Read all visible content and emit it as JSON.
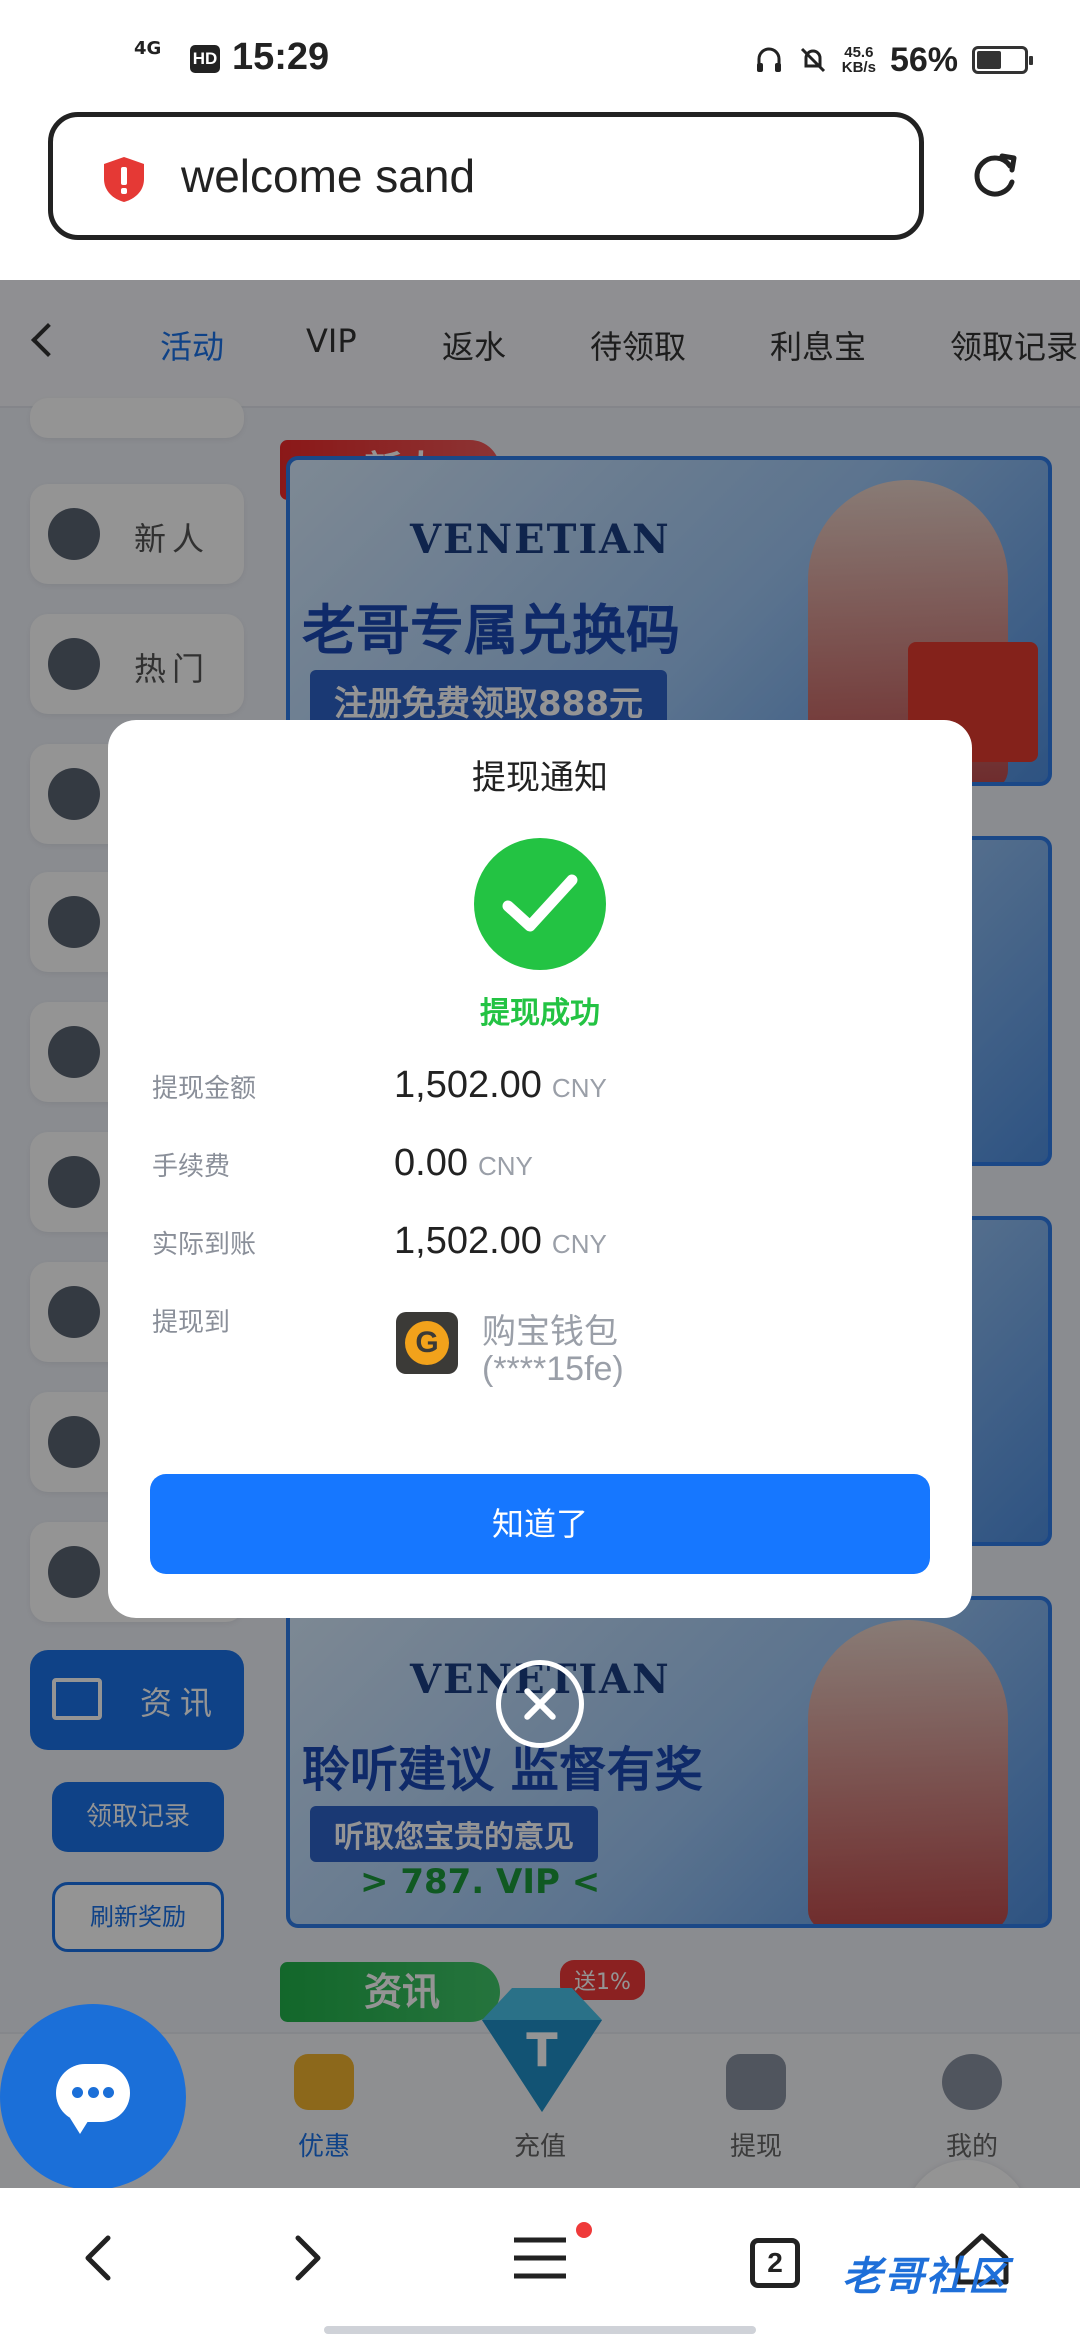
{
  "status_bar": {
    "network": "4G",
    "hd": "HD",
    "time": "15:29",
    "speed_value": "45.6",
    "speed_unit": "KB/s",
    "battery": "56%"
  },
  "browser": {
    "url_text": "welcome sand",
    "tabs_count": "2",
    "watermark": "老哥社区"
  },
  "top_nav": {
    "tabs": [
      "活动",
      "VIP",
      "返水",
      "待领取",
      "利息宝",
      "领取记录"
    ],
    "active_index": 0
  },
  "sidebar": {
    "items": [
      "新人",
      "热门"
    ],
    "active": "资讯",
    "claim_records": "领取记录",
    "refresh_reward": "刷新奖励"
  },
  "banners": {
    "tag_new": "新人",
    "brand": "VENETIAN",
    "banner1_headline": "老哥专属兑换码",
    "banner1_sub": "注册免费领取888元",
    "banner2_headline": "聆听建议 监督有奖",
    "banner2_sub": "听取您宝贵的意见",
    "banner2_site": "> 787. VIP <",
    "tag_info": "资讯",
    "badge": "送1%"
  },
  "bottom_nav": {
    "items": [
      "优惠",
      "充值",
      "提现",
      "我的"
    ],
    "active_index": 0
  },
  "modal": {
    "title": "提现通知",
    "status": "提现成功",
    "rows": [
      {
        "label": "提现金额",
        "value": "1,502.00",
        "unit": "CNY"
      },
      {
        "label": "手续费",
        "value": "0.00",
        "unit": "CNY"
      },
      {
        "label": "实际到账",
        "value": "1,502.00",
        "unit": "CNY"
      }
    ],
    "dest_label": "提现到",
    "wallet_name": "购宝钱包",
    "wallet_id": "(****15fe)",
    "confirm": "知道了"
  },
  "colors": {
    "accent": "#1677ff",
    "success": "#23c343",
    "danger": "#ef3a3a"
  }
}
